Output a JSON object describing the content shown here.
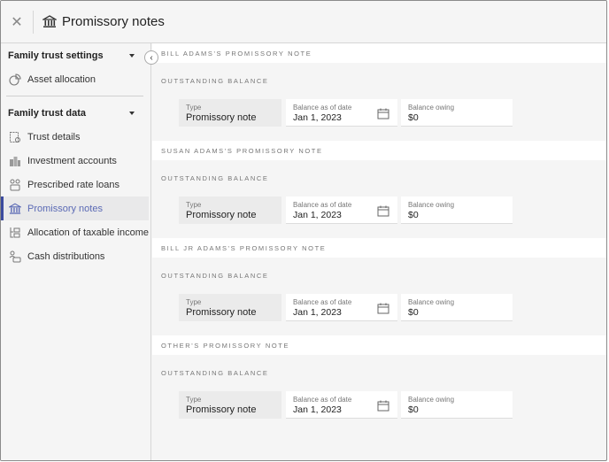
{
  "header": {
    "close_icon": "close-icon",
    "title": "Promissory notes",
    "title_icon": "bank-icon"
  },
  "sidebar": {
    "sections": [
      {
        "label": "Family trust settings",
        "items": [
          {
            "label": "Asset allocation",
            "icon": "pie-chart-icon"
          }
        ]
      },
      {
        "label": "Family trust data",
        "items": [
          {
            "label": "Trust details",
            "icon": "document-icon"
          },
          {
            "label": "Investment accounts",
            "icon": "buildings-icon"
          },
          {
            "label": "Prescribed rate loans",
            "icon": "people-money-icon"
          },
          {
            "label": "Promissory notes",
            "icon": "bank-icon",
            "active": true
          },
          {
            "label": "Allocation of taxable income",
            "icon": "allocation-icon"
          },
          {
            "label": "Cash distributions",
            "icon": "person-cash-icon"
          }
        ]
      }
    ],
    "collapse_icon": "chevron-left-icon"
  },
  "notes": [
    {
      "title": "BILL ADAMS'S PROMISSORY NOTE",
      "section": "OUTSTANDING BALANCE",
      "type_label": "Type",
      "type_value": "Promissory note",
      "date_label": "Balance as of date",
      "date_value": "Jan 1, 2023",
      "owing_label": "Balance owing",
      "owing_value": "$0"
    },
    {
      "title": "SUSAN ADAMS'S PROMISSORY NOTE",
      "section": "OUTSTANDING BALANCE",
      "type_label": "Type",
      "type_value": "Promissory note",
      "date_label": "Balance as of date",
      "date_value": "Jan 1, 2023",
      "owing_label": "Balance owing",
      "owing_value": "$0"
    },
    {
      "title": "BILL JR ADAMS'S PROMISSORY NOTE",
      "section": "OUTSTANDING BALANCE",
      "type_label": "Type",
      "type_value": "Promissory note",
      "date_label": "Balance as of date",
      "date_value": "Jan 1, 2023",
      "owing_label": "Balance owing",
      "owing_value": "$0"
    },
    {
      "title": "OTHER'S PROMISSORY NOTE",
      "section": "OUTSTANDING BALANCE",
      "type_label": "Type",
      "type_value": "Promissory note",
      "date_label": "Balance as of date",
      "date_value": "Jan 1, 2023",
      "owing_label": "Balance owing",
      "owing_value": "$0"
    }
  ]
}
